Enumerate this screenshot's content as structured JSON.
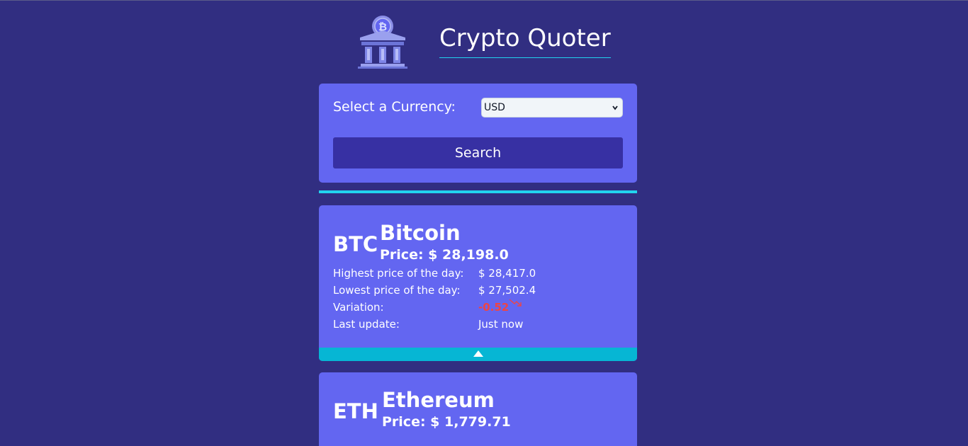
{
  "app": {
    "title": "Crypto Quoter",
    "logo_icon": "bitcoin-bank-icon"
  },
  "form": {
    "label": "Select a Currency:",
    "currency_value": "USD",
    "search_label": "Search"
  },
  "coins": [
    {
      "symbol": "BTC",
      "name": "Bitcoin",
      "price": "Price: $ 28,198.0",
      "details": {
        "high_label": "Highest price of the day:",
        "high_value": "$ 28,417.0",
        "low_label": "Lowest price of the day:",
        "low_value": "$ 27,502.4",
        "variation_label": "Variation:",
        "variation_value": "-0.52",
        "updated_label": "Last update:",
        "updated_value": "Just now"
      },
      "trend_icon": "trend-down-icon",
      "toggle_icon": "chevron-up-icon"
    },
    {
      "symbol": "ETH",
      "name": "Ethereum",
      "price": "Price: $ 1,779.71"
    }
  ],
  "colors": {
    "background": "#312e81",
    "card": "#6366f1",
    "button": "#3730a3",
    "accent": "#22d3ee",
    "negative": "#ef4444"
  }
}
